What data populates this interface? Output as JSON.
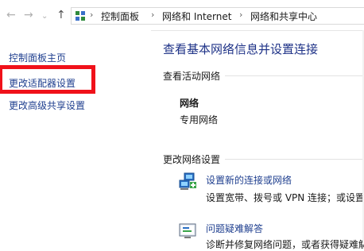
{
  "address_bar": {
    "breadcrumbs": [
      "控制面板",
      "网络和 Internet",
      "网络和共享中心"
    ]
  },
  "sidebar": {
    "items": [
      {
        "label": "控制面板主页"
      },
      {
        "label": "更改适配器设置"
      },
      {
        "label": "更改高级共享设置"
      }
    ],
    "highlight_color": "#f0111a"
  },
  "main": {
    "title": "查看基本网络信息并设置连接",
    "active_networks_label": "查看活动网络",
    "network": {
      "name": "网络",
      "type": "专用网络"
    },
    "change_settings_label": "更改网络设置",
    "tasks": [
      {
        "title": "设置新的连接或网络",
        "description": "设置宽带、拨号或 VPN 连接；或设置",
        "icon": "network-setup-icon"
      },
      {
        "title": "问题疑难解答",
        "description": "诊断并修复网络问题，或者获得疑难解",
        "icon": "troubleshoot-icon"
      }
    ],
    "link_color": "#1f3f8f",
    "title_color": "#1e3287"
  }
}
